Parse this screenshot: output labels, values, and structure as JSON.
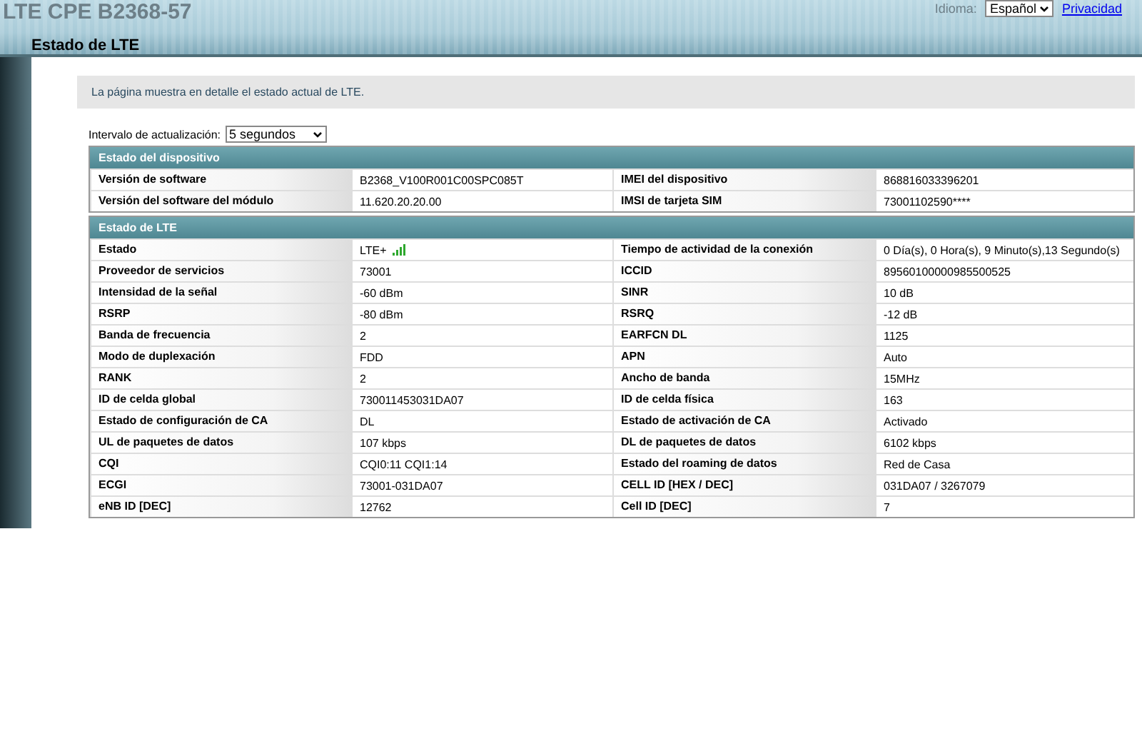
{
  "header": {
    "title": "LTE CPE B2368-57",
    "language_label": "Idioma:",
    "language_value": "Español",
    "links": [
      "Privacidad"
    ]
  },
  "page_title": "Estado de LTE",
  "info": "La página muestra en detalle el estado actual de LTE.",
  "refresh": {
    "label": "Intervalo de actualización:",
    "value": "5 segundos"
  },
  "sections": [
    {
      "title": "Estado del dispositivo",
      "rows": [
        {
          "cells": [
            "Versión de software",
            "B2368_V100R001C00SPC085T",
            "IMEI del dispositivo",
            "868816033396201"
          ]
        },
        {
          "cells": [
            "Versión del software del módulo",
            "11.620.20.20.00",
            "IMSI de tarjeta SIM",
            "73001102590****"
          ]
        }
      ]
    },
    {
      "title": "Estado de LTE",
      "rows": [
        {
          "cells": [
            "Estado",
            "LTE+",
            "Tiempo de actividad de la conexión",
            "0 Día(s), 0 Hora(s), 9 Minuto(s),13 Segundo(s)"
          ],
          "signal": true
        },
        {
          "cells": [
            "Proveedor de servicios",
            "73001",
            "ICCID",
            "89560100000985500525"
          ]
        },
        {
          "cells": [
            "Intensidad de la señal",
            "-60 dBm",
            "SINR",
            "10 dB"
          ]
        },
        {
          "cells": [
            "RSRP",
            "-80 dBm",
            "RSRQ",
            "-12 dB"
          ]
        },
        {
          "cells": [
            "Banda de frecuencia",
            "2",
            "EARFCN DL",
            "1125"
          ]
        },
        {
          "cells": [
            "Modo de duplexación",
            "FDD",
            "APN",
            "Auto"
          ]
        },
        {
          "cells": [
            "RANK",
            "2",
            "Ancho de banda",
            "15MHz"
          ]
        },
        {
          "cells": [
            "ID de celda global",
            "730011453031DA07",
            "ID de celda física",
            "163"
          ]
        },
        {
          "cells": [
            "Estado de configuración de CA",
            "DL",
            "Estado de activación de CA",
            "Activado"
          ]
        },
        {
          "cells": [
            "UL de paquetes de datos",
            "107 kbps",
            "DL de paquetes de datos",
            "6102 kbps"
          ]
        },
        {
          "cells": [
            "CQI",
            "CQI0:11 CQI1:14",
            "Estado del roaming de datos",
            "Red de Casa"
          ]
        },
        {
          "cells": [
            "ECGI",
            "73001-031DA07",
            "CELL ID [HEX / DEC]",
            "031DA07 / 3267079"
          ]
        },
        {
          "cells": [
            "eNB ID [DEC]",
            "12762",
            "Cell ID [DEC]",
            "7"
          ]
        }
      ]
    }
  ]
}
